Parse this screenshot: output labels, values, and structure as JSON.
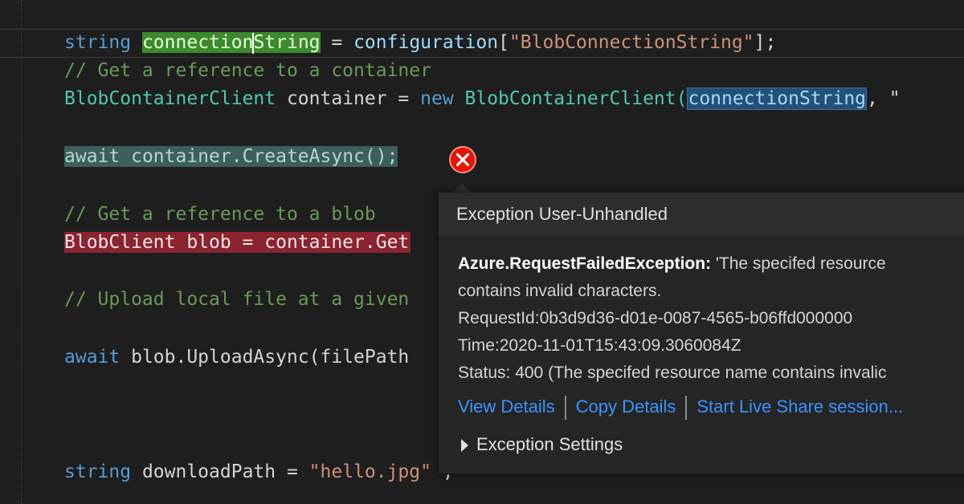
{
  "editor": {
    "line1": {
      "type": "string",
      "var_pre": "connection",
      "var_post": "String",
      "assign": " = ",
      "method": "configuration",
      "open": "[",
      "key": "\"BlobConnectionString\"",
      "close": "];"
    },
    "line2": {
      "comment": "// Get a reference to a container"
    },
    "line3": {
      "type": "BlobContainerClient",
      "var": " container = ",
      "kw_new": "new",
      "ctor": " BlobContainerClient(",
      "arg": "connectionString",
      "rest": ", \""
    },
    "line4": {
      "kw_await": "await",
      "expr": " container.CreateAsync();"
    },
    "line5": {
      "comment": "// Get a reference to a blob"
    },
    "line6": {
      "code": "BlobClient blob = container.Get"
    },
    "line7": {
      "comment": "// Upload local file at a given"
    },
    "line8": {
      "kw_await": "await",
      "expr": " blob.UploadAsync(filePath"
    },
    "line9": {
      "type": "string",
      "var": " downloadPath",
      "assign": " = ",
      "value": "\"hello.jpg\"",
      "tail": " ,"
    }
  },
  "exception_popup": {
    "title": "Exception User-Unhandled",
    "exception_type": "Azure.RequestFailedException:",
    "message_line1": " 'The specifed resource",
    "message_line2": "contains invalid characters.",
    "request_id": "RequestId:0b3d9d36-d01e-0087-4565-b06ffd000000",
    "time": "Time:2020-11-01T15:43:09.3060084Z",
    "status": "Status: 400 (The specifed resource name contains invalic",
    "links": {
      "view_details": "View Details",
      "copy_details": "Copy Details",
      "live_share": "Start Live Share session..."
    },
    "settings_label": "Exception Settings"
  },
  "colors": {
    "editor_bg": "#1e1e1e",
    "keyword": "#569cd6",
    "type": "#4ec9b0",
    "string": "#ce9178",
    "comment": "#6a9955",
    "error_highlight": "#8b2330",
    "link": "#3794ff",
    "error_icon": "#e51400"
  },
  "icons": {
    "error_glyph": "error-circle-x-icon",
    "expand": "chevron-right-icon"
  }
}
